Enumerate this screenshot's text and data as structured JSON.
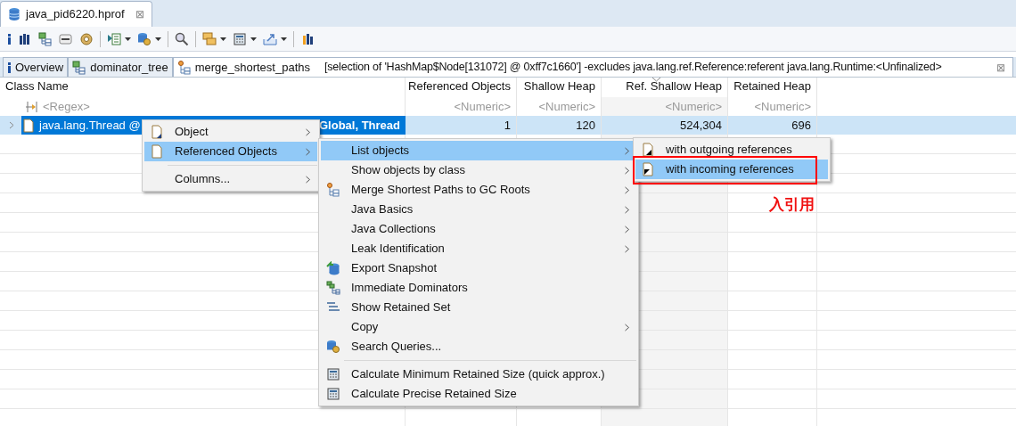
{
  "editor_tab": {
    "title": "java_pid6220.hprof",
    "close": "⊠"
  },
  "view_tabs": [
    {
      "label": "Overview",
      "selected": false
    },
    {
      "label": "dominator_tree",
      "selected": false
    },
    {
      "label": "merge_shortest_paths",
      "selected": true,
      "detail": "[selection of 'HashMap$Node[131072] @ 0xff7c1660'] -excludes java.lang.ref.Reference:referent java.lang.Runtime:<Unfinalized>",
      "close": "⊠"
    }
  ],
  "table": {
    "columns": [
      {
        "title": "Class Name",
        "filter": "<Regex>",
        "sorted": false
      },
      {
        "title": "Referenced Objects",
        "filter": "<Numeric>",
        "sorted": false
      },
      {
        "title": "Shallow Heap",
        "filter": "<Numeric>",
        "sorted": false
      },
      {
        "title": "Ref. Shallow Heap",
        "filter": "<Numeric>",
        "sorted": true
      },
      {
        "title": "Retained Heap",
        "filter": "<Numeric>",
        "sorted": false
      }
    ],
    "rows": [
      {
        "selected": true,
        "cells": [
          {
            "start": "java.lang.Thread @",
            "end": "Global, Thread"
          },
          "1",
          "120",
          "524,304",
          "696"
        ]
      }
    ]
  },
  "context_menu": [
    {
      "kind": "item",
      "label": "Object",
      "submenu": true,
      "selected": false
    },
    {
      "kind": "item",
      "label": "Referenced Objects",
      "submenu": true,
      "selected": true
    },
    {
      "kind": "separator"
    },
    {
      "kind": "item",
      "label": "Columns...",
      "submenu": true,
      "selected": false
    }
  ],
  "submenu": [
    {
      "kind": "item",
      "label": "List objects",
      "submenu": true,
      "selected": true
    },
    {
      "kind": "item",
      "label": "Show objects by class",
      "submenu": true,
      "selected": false
    },
    {
      "kind": "item",
      "label": "Merge Shortest Paths to GC Roots",
      "submenu": true,
      "selected": false
    },
    {
      "kind": "item",
      "label": "Java Basics",
      "submenu": true,
      "selected": false
    },
    {
      "kind": "item",
      "label": "Java Collections",
      "submenu": true,
      "selected": false
    },
    {
      "kind": "item",
      "label": "Leak Identification",
      "submenu": true,
      "selected": false
    },
    {
      "kind": "item",
      "label": "Export Snapshot",
      "submenu": false,
      "selected": false
    },
    {
      "kind": "item",
      "label": "Immediate Dominators",
      "submenu": false,
      "selected": false
    },
    {
      "kind": "item",
      "label": "Show Retained Set",
      "submenu": false,
      "selected": false
    },
    {
      "kind": "item",
      "label": "Copy",
      "submenu": true,
      "selected": false
    },
    {
      "kind": "item",
      "label": "Search Queries...",
      "submenu": false,
      "selected": false
    },
    {
      "kind": "separator"
    },
    {
      "kind": "item",
      "label": "Calculate Minimum Retained Size (quick approx.)",
      "submenu": false,
      "selected": false
    },
    {
      "kind": "item",
      "label": "Calculate Precise Retained Size",
      "submenu": false,
      "selected": false
    }
  ],
  "list_objects_menu": [
    {
      "kind": "item",
      "label": "with outgoing references",
      "submenu": false,
      "selected": false
    },
    {
      "kind": "item",
      "label": "with incoming references",
      "submenu": false,
      "selected": true
    }
  ],
  "annotation": {
    "text": "入引用"
  }
}
